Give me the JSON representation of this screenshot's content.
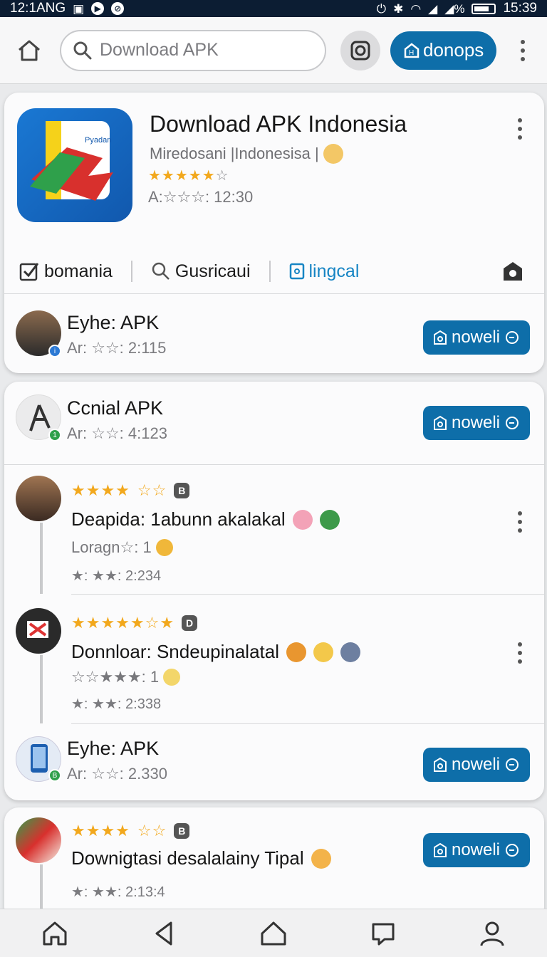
{
  "status": {
    "time_left": "12:1ANG",
    "time_right": "15:39"
  },
  "search": {
    "placeholder": "Download APK"
  },
  "header": {
    "action_label": "donops"
  },
  "app": {
    "title": "Download APK Indonesia",
    "subtitle": "Miredosani |Indonesisa |",
    "meta": "A:☆☆☆: 12:30",
    "icon_text": "Pyadan"
  },
  "tabs": [
    {
      "label": "bomania"
    },
    {
      "label": "Gusricaui"
    },
    {
      "label": "lingcal"
    }
  ],
  "list": [
    {
      "title": "Eyhe: APK",
      "meta": "Ar: ☆☆: 2:115",
      "button": "noweli"
    },
    {
      "title": "Ccnial APK",
      "meta": "Ar: ☆☆: 4:123",
      "button": "noweli"
    },
    {
      "title": "Eyhe: APK",
      "meta": "Ar: ☆☆: 2.330",
      "button": "noweli"
    }
  ],
  "reviews": [
    {
      "text": "Deapida: 1abunn akalakal",
      "sub": "Loragn☆: 1",
      "meta": "★: ★★: 2:234"
    },
    {
      "text": "Donnloar: Sndeupinalatal",
      "sub": "☆☆★★★: 1",
      "meta": "★: ★★: 2:338"
    },
    {
      "text": "Downigtasi desalalainy Tipal",
      "meta": "★: ★★: 2:13:4",
      "button": "noweli"
    }
  ],
  "colors": {
    "accent": "#0e6ea9",
    "star": "#f2a81d",
    "status_bar": "#0c1d33"
  },
  "icons": [
    "home-icon",
    "search-icon",
    "camera-icon",
    "more-icon",
    "back-icon",
    "chat-icon",
    "profile-icon"
  ]
}
